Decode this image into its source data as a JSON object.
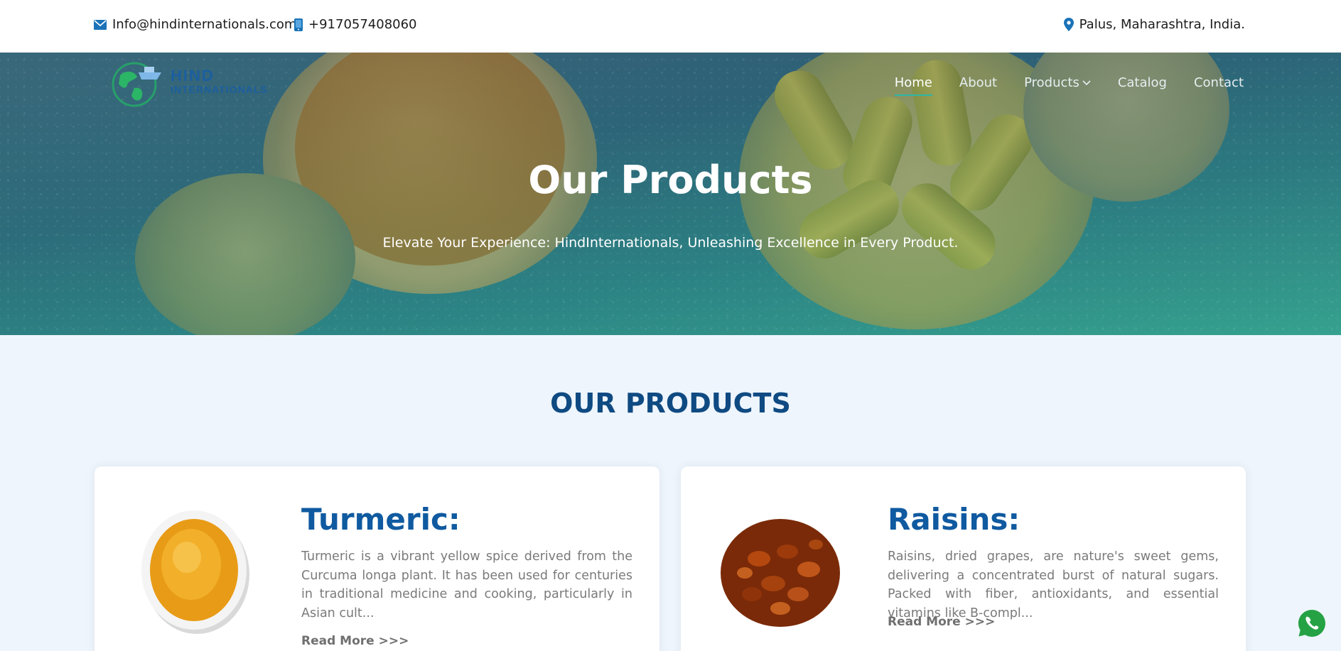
{
  "topbar": {
    "email": "Info@hindinternationals.com",
    "phone": "+917057408060",
    "location": "Palus, Maharashtra, India."
  },
  "logo": {
    "line1": "HIND",
    "line2": "INTERNATIONALS",
    "icon": "globe-ship-logo"
  },
  "nav": {
    "items": [
      {
        "label": "Home",
        "active": true
      },
      {
        "label": "About"
      },
      {
        "label": "Products",
        "has_dropdown": true
      },
      {
        "label": "Catalog"
      },
      {
        "label": "Contact"
      }
    ]
  },
  "hero": {
    "title": "Our Products",
    "subtitle": "Elevate Your Experience: HindInternationals, Unleashing Excellence in Every Product."
  },
  "section": {
    "title": "OUR PRODUCTS"
  },
  "products": [
    {
      "title": "Turmeric:",
      "description": "Turmeric is a vibrant yellow spice derived from the Curcuma longa plant. It has been used for centuries in traditional medicine and cooking, particularly in Asian cult...",
      "read_more": "Read More >>>"
    },
    {
      "title": "Raisins:",
      "description": "Raisins, dried grapes, are nature's sweet gems, delivering a concentrated burst of natural sugars. Packed with fiber, antioxidants, and essential vitamins like B-compl...",
      "read_more": "Read More >>>"
    }
  ],
  "colors": {
    "brand_blue": "#0f4a82",
    "product_title": "#0f5aa0",
    "nav_underline": "#2fb6a6",
    "whatsapp_green": "#25a244",
    "icon_blue": "#1a73b8"
  },
  "icons": [
    "envelope-icon",
    "phone-icon",
    "location-pin-icon",
    "chevron-down-icon",
    "whatsapp-icon"
  ]
}
